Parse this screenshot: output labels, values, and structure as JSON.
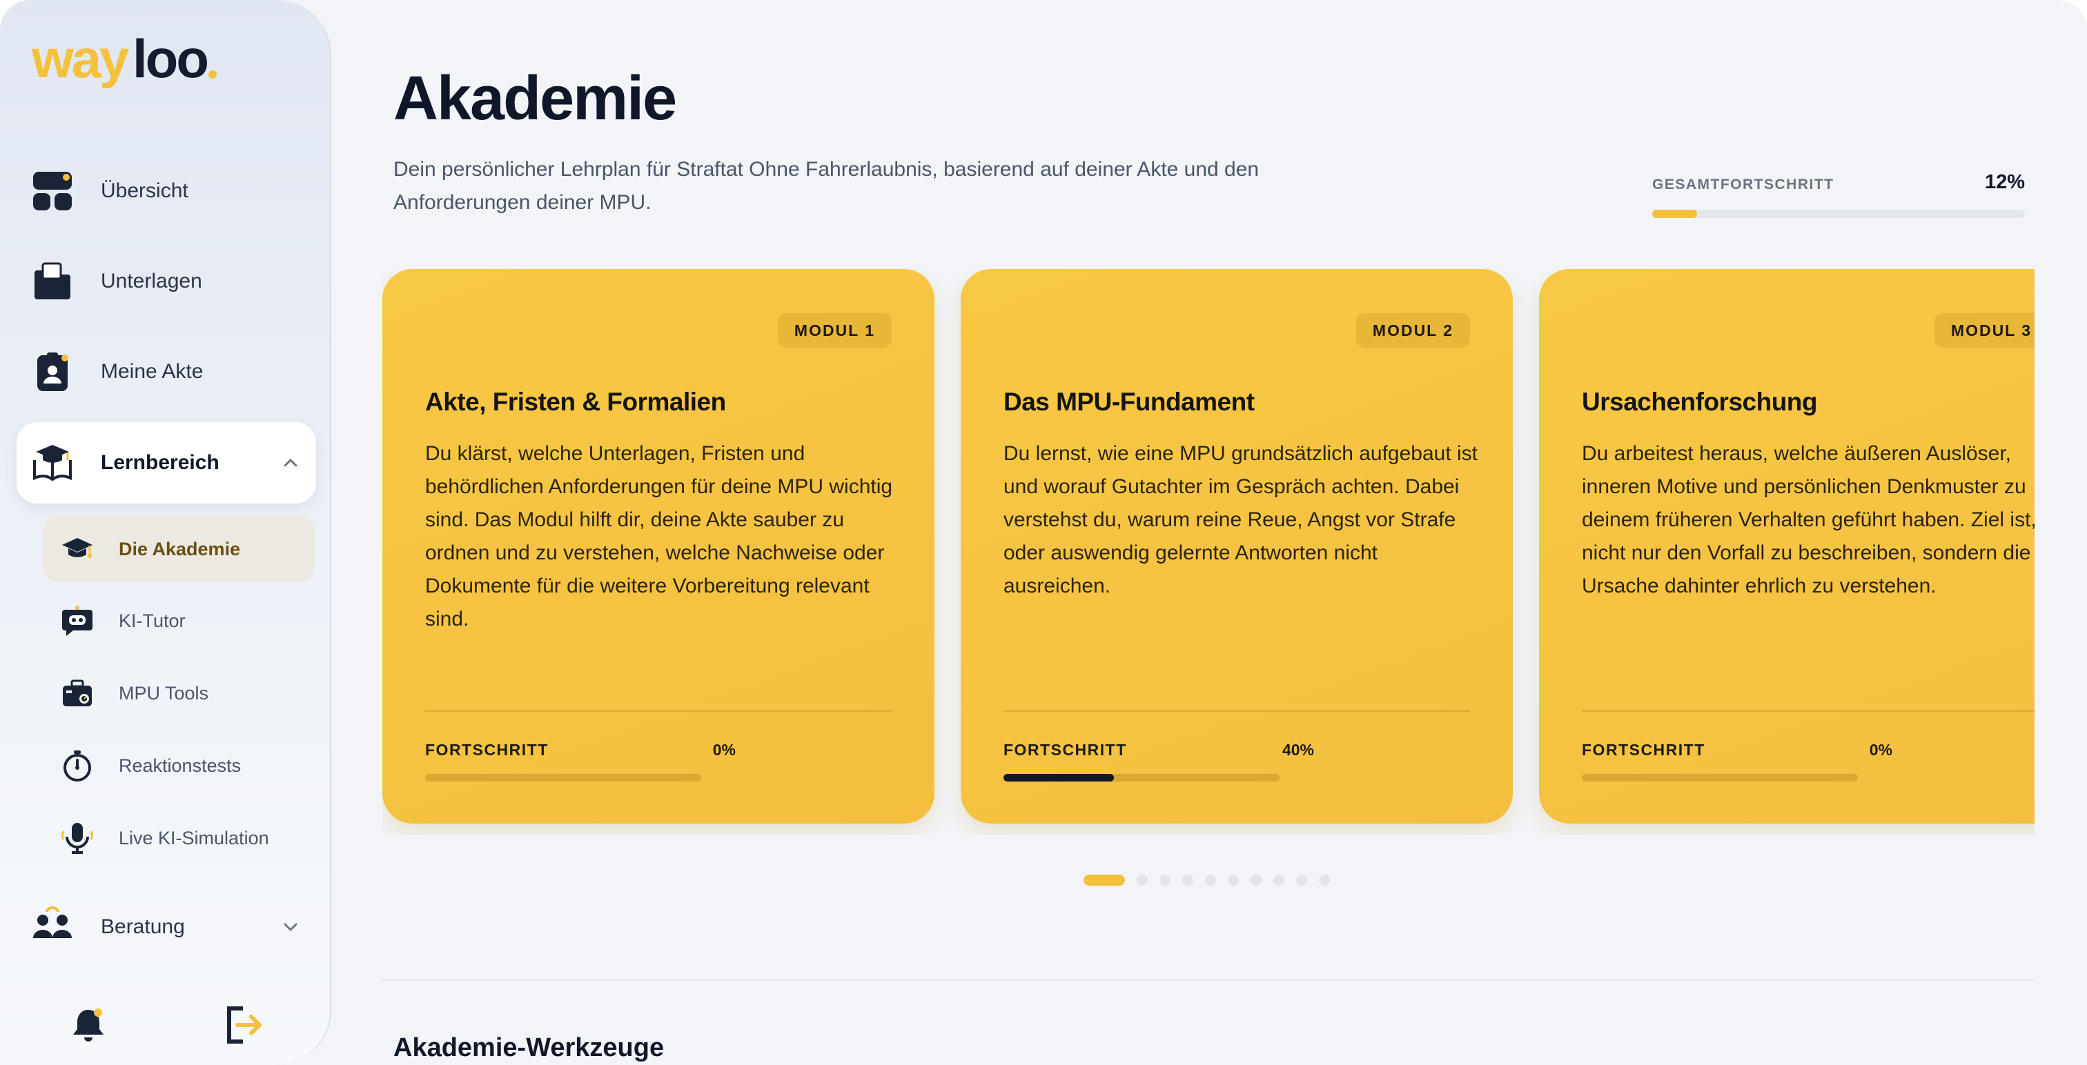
{
  "brand": {
    "logo_text_primary": "way",
    "logo_text_secondary": "loo",
    "logo_dot": "."
  },
  "sidebar": {
    "items": [
      {
        "label": "Übersicht",
        "icon": "dashboard-icon"
      },
      {
        "label": "Unterlagen",
        "icon": "folder-icon"
      },
      {
        "label": "Meine Akte",
        "icon": "id-badge-icon"
      },
      {
        "label": "Lernbereich",
        "icon": "book-graduation-icon",
        "expanded": true
      },
      {
        "label": "Beratung",
        "icon": "people-icon",
        "expanded": false
      }
    ],
    "sub_items": [
      {
        "label": "Die Akademie",
        "icon": "graduation-cap-icon",
        "active": true
      },
      {
        "label": "KI-Tutor",
        "icon": "robot-chat-icon"
      },
      {
        "label": "MPU Tools",
        "icon": "toolbox-icon"
      },
      {
        "label": "Reaktionstests",
        "icon": "stopwatch-icon"
      },
      {
        "label": "Live KI-Simulation",
        "icon": "microphone-icon"
      }
    ],
    "bottom": {
      "notifications_icon": "bell-icon",
      "logout_icon": "logout-icon"
    }
  },
  "main": {
    "title": "Akademie",
    "subtitle": "Dein persönlicher Lehrplan für Straftat Ohne Fahrerlaubnis, basierend auf deiner Akte und den Anforderungen deiner MPU.",
    "overall_progress": {
      "label": "GESAMTFORTSCHRITT",
      "value_text": "12%",
      "value": 12
    },
    "modules": [
      {
        "badge": "MODUL 1",
        "title": "Akte, Fristen & Formalien",
        "description": "Du klärst, welche Unterlagen, Fristen und behördlichen Anforderungen für deine MPU wichtig sind. Das Modul hilft dir, deine Akte sauber zu ordnen und zu verstehen, welche Nachweise oder Dokumente für die weitere Vorbereitung relevant sind.",
        "progress_label": "FORTSCHRITT",
        "progress_text": "0%",
        "progress": 0
      },
      {
        "badge": "MODUL 2",
        "title": "Das MPU-Fundament",
        "description": "Du lernst, wie eine MPU grundsätzlich aufgebaut ist und worauf Gutachter im Gespräch achten. Dabei verstehst du, warum reine Reue, Angst vor Strafe oder auswendig gelernte Antworten nicht ausreichen.",
        "progress_label": "FORTSCHRITT",
        "progress_text": "40%",
        "progress": 40
      },
      {
        "badge": "MODUL 3",
        "title": "Ursachenforschung",
        "description": "Du arbeitest heraus, welche äußeren Auslöser, inneren Motive und persönlichen Denkmuster zu deinem früheren Verhalten geführt haben. Ziel ist, nicht nur den Vorfall zu beschreiben, sondern die Ursache dahinter ehrlich zu verstehen.",
        "progress_label": "FORTSCHRITT",
        "progress_text": "0%",
        "progress": 0
      }
    ],
    "carousel_pages": 10,
    "carousel_active_page": 1,
    "section_title": "Akademie-Werkzeuge"
  },
  "colors": {
    "accent": "#f4c13d",
    "dark": "#0f1729",
    "background": "#f2f4f7"
  }
}
